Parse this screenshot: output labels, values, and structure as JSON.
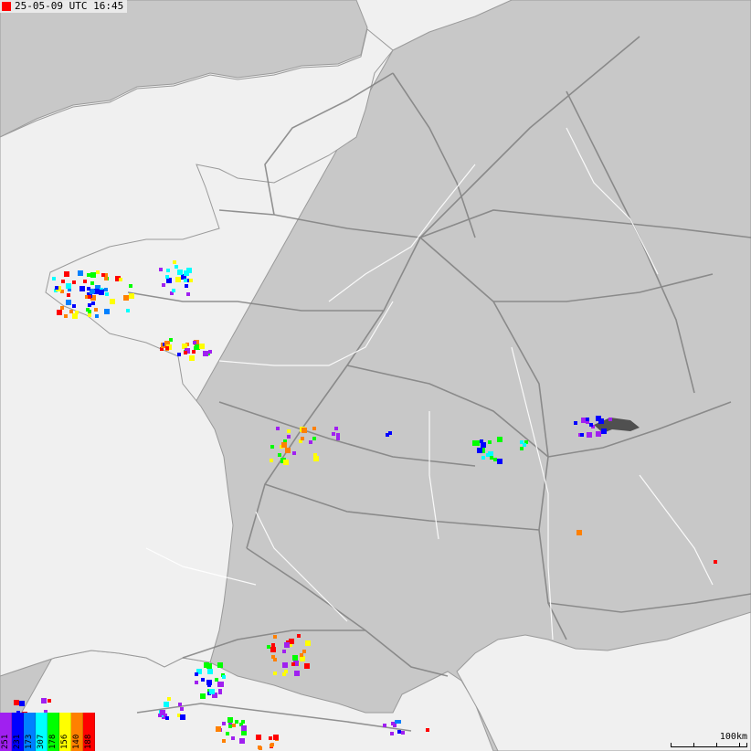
{
  "timestamp": "25-05-09 UTC 16:45",
  "scale_label": "100km",
  "legend": [
    {
      "label": "251",
      "color": "#a020f0"
    },
    {
      "label": "231",
      "color": "#0000ff"
    },
    {
      "label": "173",
      "color": "#0080ff"
    },
    {
      "label": "307",
      "color": "#00ffff"
    },
    {
      "label": "178",
      "color": "#00ff00"
    },
    {
      "label": "156",
      "color": "#ffff00"
    },
    {
      "label": "140",
      "color": "#ff8000"
    },
    {
      "label": "188",
      "color": "#ff0000"
    }
  ],
  "colors": {
    "sea": "#f0f0f0",
    "land": "#c8c8c8",
    "roads": "#808080",
    "rivers": "#ffffff"
  }
}
